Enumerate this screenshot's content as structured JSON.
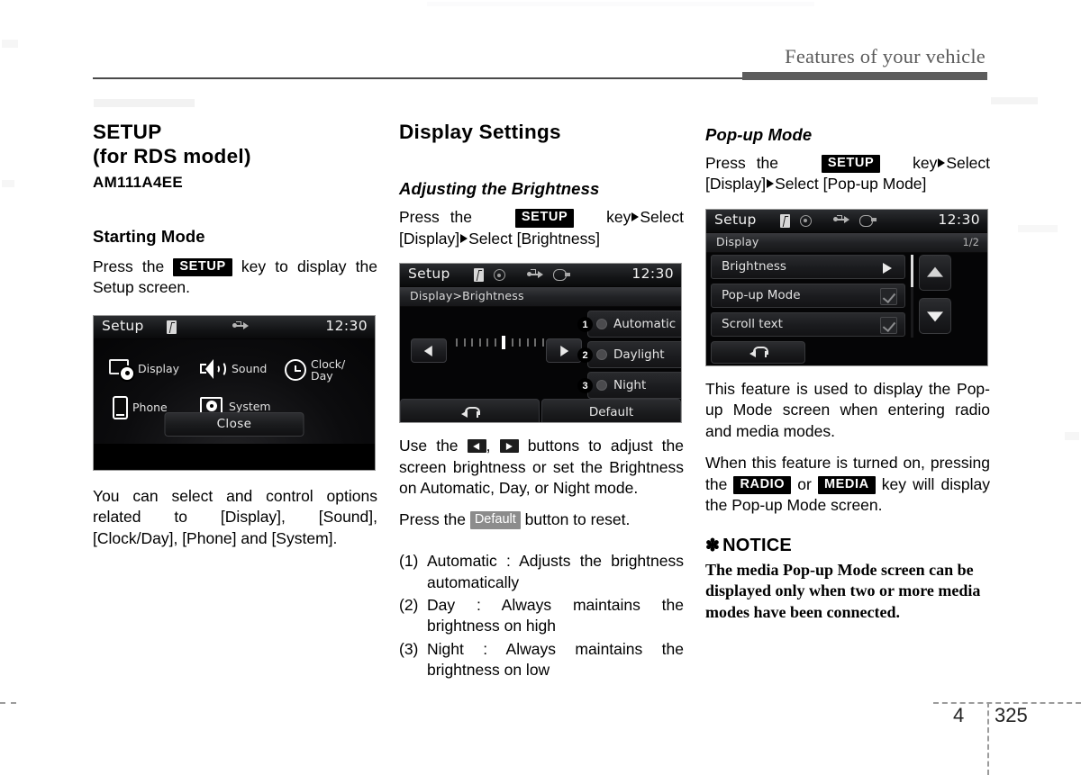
{
  "header": {
    "title": "Features of your vehicle"
  },
  "footer": {
    "chapter": "4",
    "page": "325"
  },
  "column_left": {
    "section_title_line1": "SETUP",
    "section_title_line2": "(for RDS model)",
    "model_code": "AM111A4EE",
    "subheading": "Starting Mode",
    "instruction_prefix": "Press the",
    "setup_key": "SETUP",
    "instruction_suffix": "key to display the Setup screen.",
    "description": "You can select and control options related to [Display], [Sound], [Clock/Day], [Phone] and [System].",
    "screen": {
      "title": "Setup",
      "clock": "12:30",
      "status_icons": [
        "bluetooth-icon",
        "usb-icon"
      ],
      "tiles": [
        {
          "label": "Display",
          "icon": "display-gear-icon"
        },
        {
          "label": "Sound",
          "icon": "speaker-icon"
        },
        {
          "label": "Clock/\nDay",
          "icon": "clock-icon"
        },
        {
          "label": "Phone",
          "icon": "phone-icon"
        },
        {
          "label": "System",
          "icon": "folder-gear-icon"
        }
      ],
      "tile_labels": {
        "display": "Display",
        "sound": "Sound",
        "clock_line1": "Clock/",
        "clock_line2": "Day",
        "phone": "Phone",
        "system": "System"
      },
      "close_button": "Close"
    }
  },
  "column_middle": {
    "section_title": "Display Settings",
    "subheading": "Adjusting the Brightness",
    "instruction_prefix": "Press the",
    "setup_key": "SETUP",
    "instruction_mid": "key",
    "instruction_select1": "Select [Display]",
    "instruction_select2": "Select [Brightness]",
    "screen": {
      "title": "Setup",
      "clock": "12:30",
      "breadcrumb": "Display>Brightness",
      "status_icons": [
        "bluetooth-icon",
        "disc-icon",
        "usb-icon",
        "aux-icon"
      ],
      "tick_count": 13,
      "tick_active_index": 6,
      "options": [
        {
          "number": "1",
          "label": "Automatic"
        },
        {
          "number": "2",
          "label": "Daylight"
        },
        {
          "number": "3",
          "label": "Night"
        }
      ],
      "back_button": "back-arrow-icon",
      "default_button": "Default"
    },
    "use_text_1": "Use the",
    "use_text_2": ",",
    "use_text_3": "buttons to adjust the screen brightness or set the Brightness on Automatic, Day, or Night mode.",
    "reset_prefix": "Press the",
    "default_key": "Default",
    "reset_suffix": "button to reset.",
    "numbered_list": [
      {
        "num": "(1)",
        "text": "Automatic : Adjusts the brightness automatically"
      },
      {
        "num": "(2)",
        "text": "Day : Always maintains the brightness on high"
      },
      {
        "num": "(3)",
        "text": "Night : Always maintains the brightness on low"
      }
    ]
  },
  "column_right": {
    "subheading": "Pop-up Mode",
    "instruction_prefix": "Press the",
    "setup_key": "SETUP",
    "instruction_mid": "key",
    "instruction_select1": "Select [Display]",
    "instruction_select2": "Select [Pop-up Mode]",
    "screen": {
      "title": "Setup",
      "clock": "12:30",
      "breadcrumb": "Display",
      "page_indicator": "1/2",
      "status_icons": [
        "bluetooth-icon",
        "disc-icon",
        "usb-icon",
        "aux-icon"
      ],
      "rows": [
        {
          "label": "Brightness",
          "control": "chevron-right-icon"
        },
        {
          "label": "Pop-up Mode",
          "control": "checkmark-icon"
        },
        {
          "label": "Scroll text",
          "control": "checkmark-icon"
        }
      ],
      "scroll_up": "scroll-up-icon",
      "scroll_down": "scroll-down-icon",
      "back_button": "back-arrow-icon"
    },
    "paragraph_1": "This feature is used to display the Pop-up Mode screen when entering radio and media modes.",
    "paragraph_2_part1": "When this feature is turned on, pressing the",
    "radio_key": "RADIO",
    "paragraph_2_or": "or",
    "media_key": "MEDIA",
    "paragraph_2_part2": "key will display the Pop-up Mode screen.",
    "notice_star": "✽",
    "notice_title": "NOTICE",
    "notice_body": "The media Pop-up Mode screen can be displayed only when two or more media modes have been connected."
  }
}
